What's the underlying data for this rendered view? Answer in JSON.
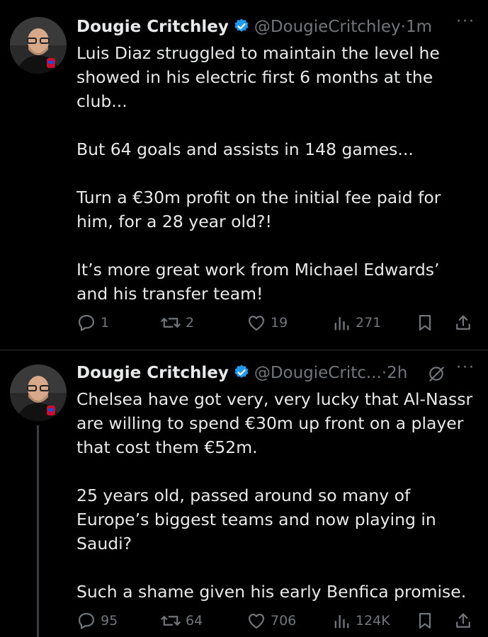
{
  "tweets": [
    {
      "name": "Dougie Critchley",
      "handle": "@DougieCritchley",
      "time": "1m",
      "paragraphs": [
        "Luis Diaz struggled to maintain the level he showed in his electric first 6 months at the club...",
        "But 64 goals and assists in 148 games...",
        "Turn a €30m profit on the initial fee paid for him, for a 28 year old?!",
        "It’s more great work from Michael Edwards’ and his transfer team!"
      ],
      "replies": "1",
      "reposts": "2",
      "likes": "19",
      "views": "271"
    },
    {
      "name": "Dougie Critchley",
      "handle": "@DougieCritc...",
      "time": "2h",
      "paragraphs": [
        "Chelsea have got very, very lucky that Al-Nassr are willing to spend €30m up front on a player that cost them €52m.",
        "25 years old, passed around so many of Europe’s biggest teams and now playing in Saudi?",
        "Such a shame given his early Benfica promise."
      ],
      "replies": "95",
      "reposts": "64",
      "likes": "706",
      "views": "124K"
    }
  ],
  "ui": {
    "dot_sep": "·",
    "more": "···"
  },
  "colors": {
    "background": "#000000",
    "text": "#e7e9ea",
    "muted": "#71767b",
    "verified": "#1d9bf0"
  }
}
